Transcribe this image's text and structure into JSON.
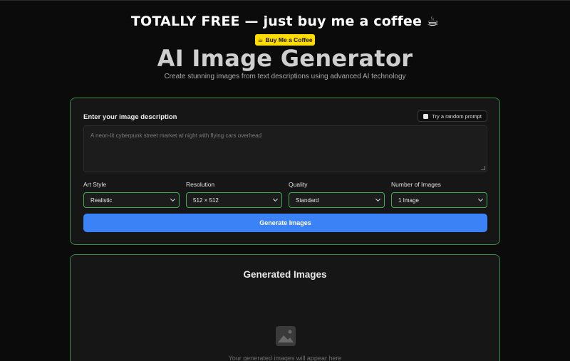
{
  "promo": {
    "title": "TOTALLY FREE — just buy me a coffee ☕",
    "coffee_button_icon": "coffee-cup-icon",
    "coffee_button_label": "Buy Me a Coffee",
    "coffee_button_color": "#ffdd00"
  },
  "hero": {
    "title": "AI Image Generator",
    "subtitle": "Create stunning images from text descriptions using advanced AI technology"
  },
  "form": {
    "description_label": "Enter your image description",
    "random_prompt_label": "Try a random prompt",
    "random_prompt_icon": "dice-icon",
    "prompt_placeholder": "A neon-lit cyberpunk street market at night with flying cars overhead",
    "fields": [
      {
        "label": "Art Style",
        "value": "Realistic"
      },
      {
        "label": "Resolution",
        "value": "512 × 512"
      },
      {
        "label": "Quality",
        "value": "Standard"
      },
      {
        "label": "Number of Images",
        "value": "1 Image"
      }
    ],
    "generate_label": "Generate Images",
    "accent_color": "#3b82f6",
    "border_color": "#3fae52"
  },
  "results": {
    "title": "Generated Images",
    "empty_icon": "image-placeholder-icon",
    "empty_text": "Your generated images will appear here"
  }
}
